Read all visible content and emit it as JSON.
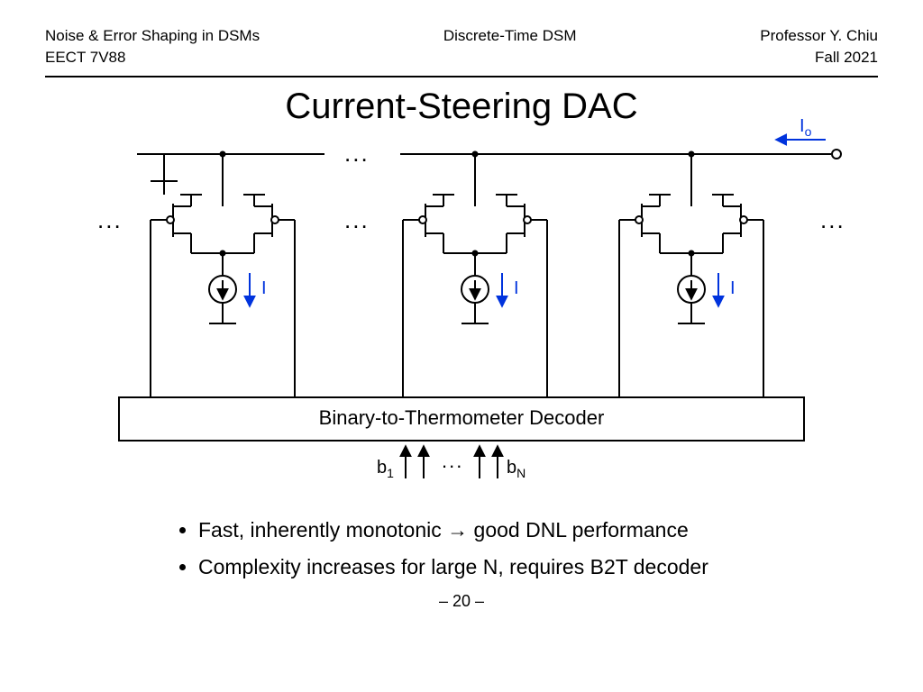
{
  "header": {
    "left_top": "Noise & Error Shaping in DSMs",
    "left_bottom": "EECT 7V88",
    "center_top": "Discrete-Time DSM",
    "right_top": "Professor Y. Chiu",
    "right_bottom": "Fall 2021"
  },
  "title": "Current-Steering DAC",
  "diagram": {
    "output_current": "I",
    "output_current_sub": "o",
    "cell_current": "I",
    "decoder": "Binary-to-Thermometer Decoder",
    "input_b1": "b",
    "input_b1_sub": "1",
    "input_bn": "b",
    "input_bn_sub": "N",
    "ellipsis": "..."
  },
  "bullets": [
    "Fast, inherently monotonic → good DNL performance",
    "Complexity increases for large N, requires B2T decoder"
  ],
  "pagenum": "– 20 –"
}
